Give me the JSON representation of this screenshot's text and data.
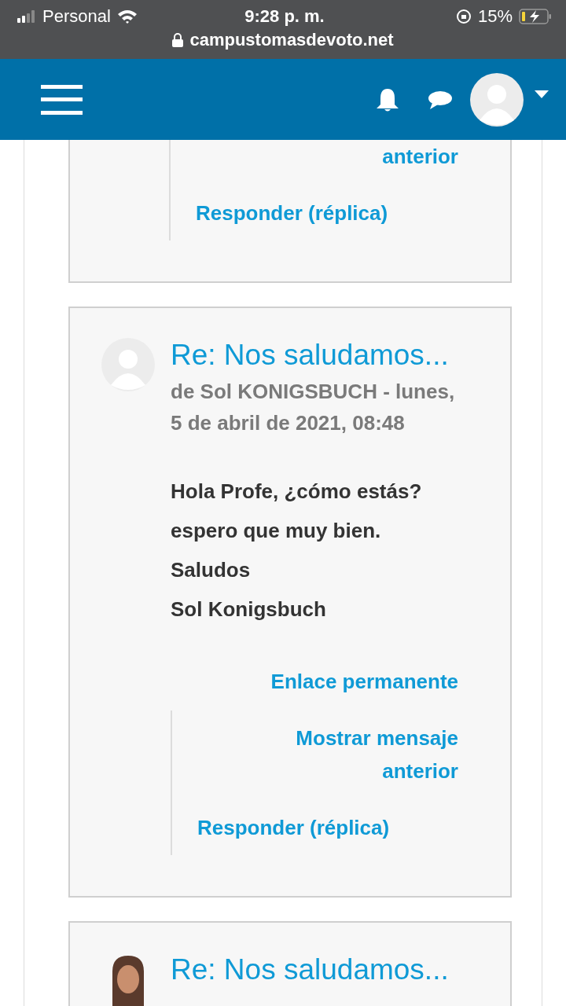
{
  "status_bar": {
    "carrier": "Personal",
    "time": "9:28 p. m.",
    "battery": "15%",
    "url": "campustomasdevoto.net"
  },
  "posts": [
    {
      "kind": "partial",
      "show_previous": "anterior",
      "reply": "Responder (réplica)"
    },
    {
      "kind": "full",
      "avatar": {
        "kind": "default"
      },
      "title": "Re: Nos saludamos...",
      "byline": "de Sol KONIGSBUCH - lunes, 5 de abril de 2021, 08:48",
      "body": [
        "Hola Profe, ¿cómo estás?",
        "espero que muy bien.",
        "Saludos",
        "Sol Konigsbuch"
      ],
      "permalink": "Enlace permanente",
      "show_previous": "Mostrar mensaje anterior",
      "reply": "Responder (réplica)"
    },
    {
      "kind": "header",
      "avatar": {
        "kind": "photo"
      },
      "title": "Re: Nos saludamos..."
    }
  ]
}
